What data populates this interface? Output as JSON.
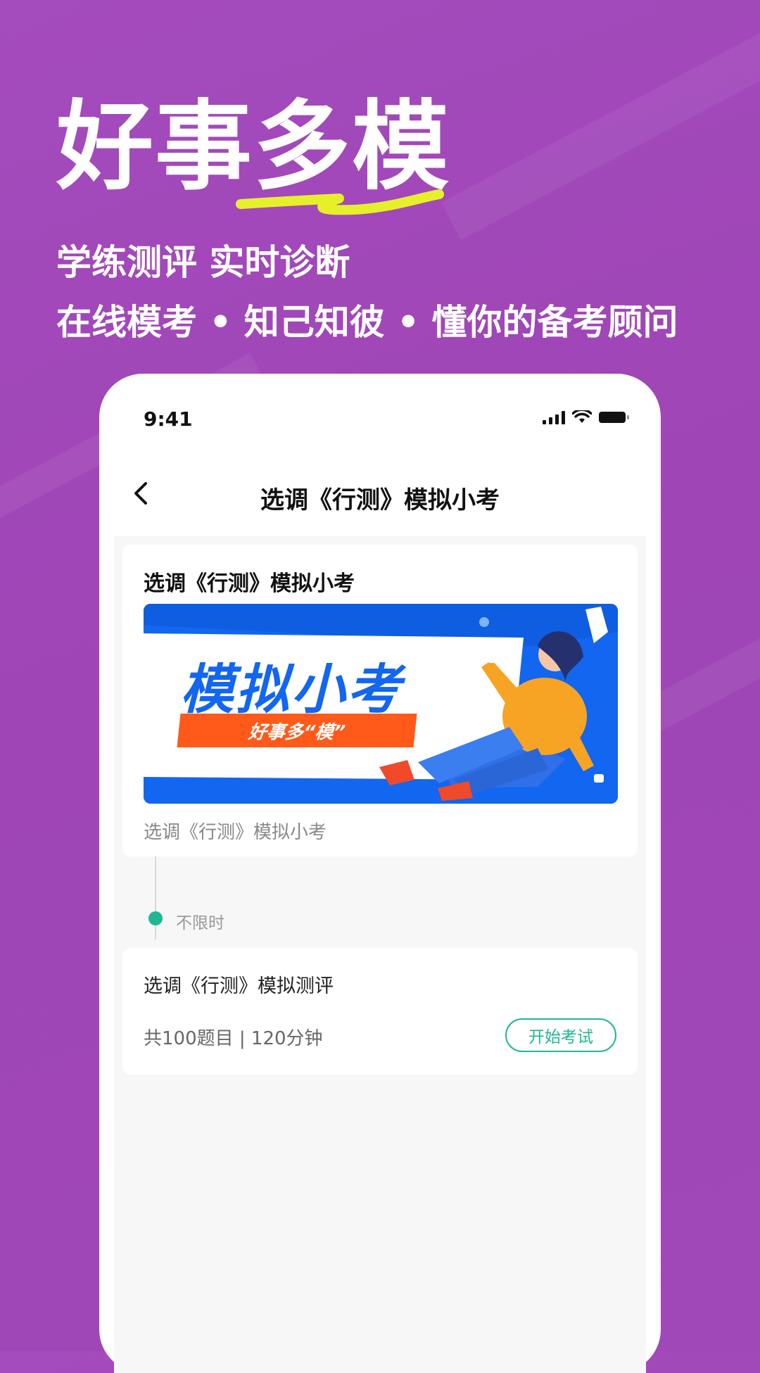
{
  "hero": {
    "title_part1": "好事",
    "title_part2": "多模",
    "subtitle_line1": "学练测评 实时诊断",
    "subtitle_line2": "在线模考 • 知己知彼 • 懂你的备考顾问"
  },
  "status_bar": {
    "time": "9:41"
  },
  "nav": {
    "title": "选调《行测》模拟小考"
  },
  "card": {
    "title": "选调《行测》模拟小考",
    "banner_title": "模拟小考",
    "banner_tag": "好事多“模”",
    "caption": "选调《行测》模拟小考"
  },
  "timeline": {
    "label": "不限时"
  },
  "exam": {
    "title": "选调《行测》模拟测评",
    "meta": "共100题目 | 120分钟",
    "start_label": "开始考试"
  },
  "colors": {
    "background": "#a048b8",
    "accent_green": "#1fb892",
    "highlight_yellow": "#e6f02a",
    "banner_blue": "#1266f0",
    "banner_orange": "#ff5a1a"
  }
}
